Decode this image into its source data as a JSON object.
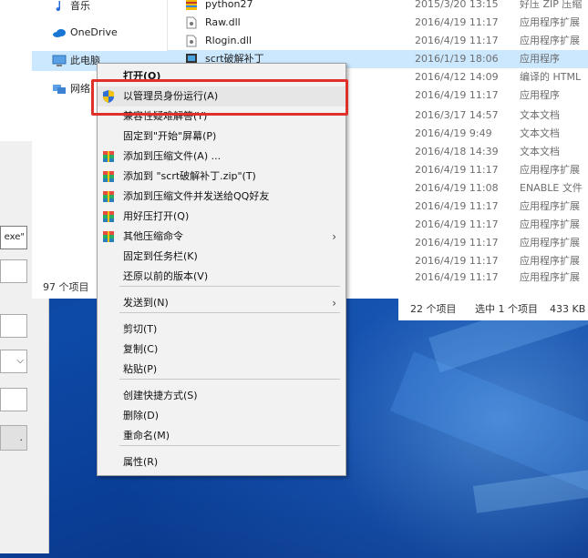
{
  "nav_pane": {
    "items": [
      {
        "label": "音乐",
        "icon": "music-note-icon"
      },
      {
        "label": "OneDrive",
        "icon": "onedrive-cloud-icon"
      },
      {
        "label": "此电脑",
        "icon": "computer-icon"
      },
      {
        "label": "网络",
        "icon": "network-icon"
      }
    ],
    "status": "97 个项目"
  },
  "files": [
    {
      "name": "python27",
      "date": "2015/3/20 13:15",
      "type": "好压 ZIP 压缩",
      "icon": "zip-archive-icon"
    },
    {
      "name": "Raw.dll",
      "date": "2016/4/19 11:17",
      "type": "应用程序扩展",
      "icon": "dll-file-icon"
    },
    {
      "name": "Rlogin.dll",
      "date": "2016/4/19 11:17",
      "type": "应用程序扩展",
      "icon": "dll-file-icon"
    },
    {
      "name": "scrt破解补丁",
      "date": "2016/1/19 18:06",
      "type": "应用程序",
      "icon": "exe-file-icon"
    },
    {
      "name": "",
      "date": "2016/4/12 14:09",
      "type": "编译的 HTML",
      "icon": ""
    },
    {
      "name": "",
      "date": "2016/4/19 11:17",
      "type": "应用程序",
      "icon": ""
    },
    {
      "name": "",
      "date": "2016/3/17 14:57",
      "type": "文本文档",
      "icon": ""
    },
    {
      "name": "",
      "date": "2016/4/19 9:49",
      "type": "文本文档",
      "icon": ""
    },
    {
      "name": "",
      "date": "2016/4/18 14:39",
      "type": "文本文档",
      "icon": ""
    },
    {
      "name": "",
      "date": "2016/4/19 11:17",
      "type": "应用程序扩展",
      "icon": ""
    },
    {
      "name": "",
      "date": "2016/4/19 11:08",
      "type": "ENABLE 文件",
      "icon": ""
    },
    {
      "name": "",
      "date": "2016/4/19 11:17",
      "type": "应用程序扩展",
      "icon": ""
    },
    {
      "name": "",
      "date": "2016/4/19 11:17",
      "type": "应用程序扩展",
      "icon": ""
    },
    {
      "name": "",
      "date": "2016/4/19 11:17",
      "type": "应用程序扩展",
      "icon": ""
    },
    {
      "name": "",
      "date": "2016/4/19 11:17",
      "type": "应用程序扩展",
      "icon": ""
    },
    {
      "name": "",
      "date": "2016/4/19 11:17",
      "type": "应用程序扩展",
      "icon": ""
    }
  ],
  "status_bar": {
    "count": "22 个项目",
    "selected": "选中 1 个项目",
    "size": "433 KB"
  },
  "left_dialog": {
    "field_text": "exe\""
  },
  "context_menu": {
    "items": [
      {
        "label": "打开(O)",
        "bold": true,
        "icon": ""
      },
      {
        "label": "以管理员身份运行(A)",
        "icon": "uac-shield-icon"
      },
      {
        "label": "兼容性疑难解答(Y)",
        "icon": ""
      },
      {
        "label": "固定到\"开始\"屏幕(P)",
        "icon": ""
      },
      {
        "label": "添加到压缩文件(A) ...",
        "icon": "winrar-icon"
      },
      {
        "label": "添加到 \"scrt破解补丁.zip\"(T)",
        "icon": "winrar-icon"
      },
      {
        "label": "添加到压缩文件并发送给QQ好友",
        "icon": "winrar-icon"
      },
      {
        "label": "用好压打开(Q)",
        "icon": "winrar-icon"
      },
      {
        "label": "其他压缩命令",
        "icon": "winrar-icon",
        "submenu": true
      },
      {
        "label": "固定到任务栏(K)",
        "icon": ""
      },
      {
        "label": "还原以前的版本(V)",
        "icon": ""
      },
      {
        "label": "发送到(N)",
        "icon": "",
        "submenu": true
      },
      {
        "label": "剪切(T)",
        "icon": ""
      },
      {
        "label": "复制(C)",
        "icon": ""
      },
      {
        "label": "粘贴(P)",
        "icon": ""
      },
      {
        "label": "创建快捷方式(S)",
        "icon": ""
      },
      {
        "label": "删除(D)",
        "icon": ""
      },
      {
        "label": "重命名(M)",
        "icon": ""
      },
      {
        "label": "属性(R)",
        "icon": ""
      }
    ],
    "submenu_arrow": "›",
    "highlight_color": "#e0302a"
  }
}
